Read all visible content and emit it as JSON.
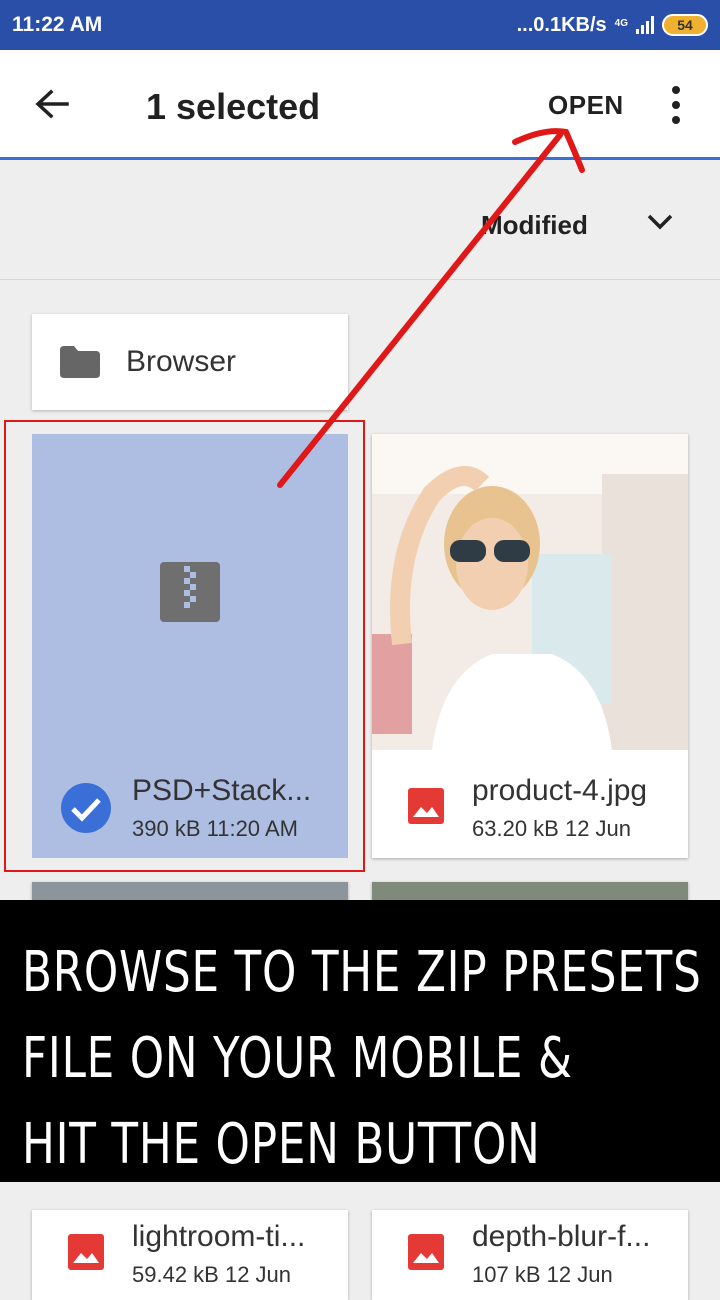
{
  "status_bar": {
    "time": "11:22 AM",
    "network_speed": "...0.1KB/s",
    "network_type": "4G",
    "battery": "54"
  },
  "toolbar": {
    "title": "1 selected",
    "open_label": "OPEN",
    "back_icon": "arrow-back-icon",
    "more_icon": "more-vert-icon"
  },
  "sort": {
    "label": "Modified",
    "icon": "chevron-down-icon"
  },
  "folder": {
    "name": "Browser",
    "icon": "folder-icon"
  },
  "files": [
    {
      "name": "PSD+Stack...",
      "size": "390 kB",
      "date": "11:20 AM",
      "type": "zip",
      "selected": true
    },
    {
      "name": "product-4.jpg",
      "size": "63.20 kB",
      "date": "12 Jun",
      "type": "image",
      "selected": false
    },
    {
      "name": "lightroom-ti...",
      "size": "59.42 kB",
      "date": "12 Jun",
      "type": "image",
      "selected": false
    },
    {
      "name": "depth-blur-f...",
      "size": "107 kB",
      "date": "12 Jun",
      "type": "image",
      "selected": false
    }
  ],
  "banner": {
    "lines": [
      "BROWSE TO THE ZIP PRESETS",
      "FILE ON YOUR MOBILE &",
      "HIT THE OPEN BUTTON"
    ]
  },
  "colors": {
    "status_bar": "#2a4fa8",
    "toolbar_underline": "#3b6fd8",
    "selected_card": "#aebee2",
    "check_circle": "#3b6fd8",
    "image_icon": "#e53935",
    "annotation": "#e01818"
  }
}
